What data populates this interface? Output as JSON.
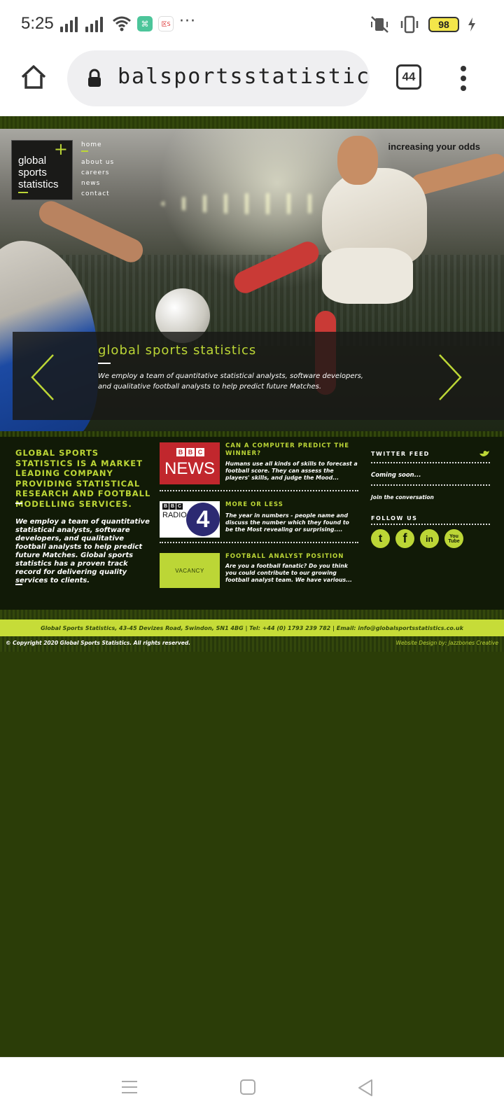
{
  "status_bar": {
    "time": "5:25",
    "battery_level": "98",
    "icons": [
      "signal-icon",
      "signal-icon",
      "wifi-icon",
      "app-notification-icon",
      "app-notification-icon",
      "more-icon",
      "vibrate-icon",
      "battery-icon",
      "charging-icon"
    ],
    "app_icon_label": "区S"
  },
  "browser": {
    "url": "balsportsstatistics.co.uk",
    "tab_count": "44"
  },
  "site": {
    "logo": {
      "line1": "global",
      "line2": "sports",
      "line3": "statistics"
    },
    "nav": [
      "home",
      "about us",
      "careers",
      "news",
      "contact"
    ],
    "tagline": "increasing your odds",
    "slide": {
      "title": "global sports statistics",
      "text": "We employ a team of quantitative statistical analysts, software developers, and qualitative football analysts to help predict future Matches."
    },
    "intro": {
      "heading": "GLOBAL SPORTS STATISTICS IS A MARKET LEADING COMPANY PROVIDING STATISTICAL RESEARCH AND FOOTBALL MODELLING SERVICES.",
      "body": "We employ a team of quantitative statistical analysts, software developers, and qualitative football analysts to help predict future Matches. Global sports statistics has a proven track record for delivering quality services to clients."
    },
    "news": [
      {
        "image_label": "NEWS",
        "title": "CAN A COMPUTER PREDICT THE WINNER?",
        "body": "Humans use all kinds of skills to forecast a football score. They can assess the players' skills, and judge the Mood..."
      },
      {
        "image_label": "RADIO",
        "title": "MORE OR LESS",
        "body": "The year in numbers - people name and discuss the number which they found to be the Most revealing or surprising...."
      },
      {
        "image_label": "VACANCY",
        "title": "FOOTBALL ANALYST POSITION",
        "body": "Are you a football fanatic? Do you think you could contribute to our growing football analyst team. We have various..."
      }
    ],
    "sidebar": {
      "twitter_heading": "TWITTER FEED",
      "twitter_status": "Coming soon...",
      "join": "Join the conversation",
      "follow_heading": "FOLLOW US",
      "social": [
        "twitter-icon",
        "facebook-icon",
        "linkedin-icon",
        "youtube-icon"
      ],
      "youtube_label": "You Tube"
    },
    "address": "Global Sports Statistics, 43-45 Devizes Road, Swindon, SN1 4BG   |   Tel: +44 (0) 1793 239 782   |   Email: info@globalsportsstatistics.co.uk",
    "copyright": "© Copyright 2020 Global Sports Statistics. All rights reserved.",
    "design_credit": "Website Design by: Jazzbones Creative"
  },
  "colors": {
    "accent": "#bcd636",
    "page_bg": "#2b3d08",
    "panel_bg": "#111a07",
    "bbc_red": "#c1272d",
    "radio4_blue": "#2c2a72"
  }
}
